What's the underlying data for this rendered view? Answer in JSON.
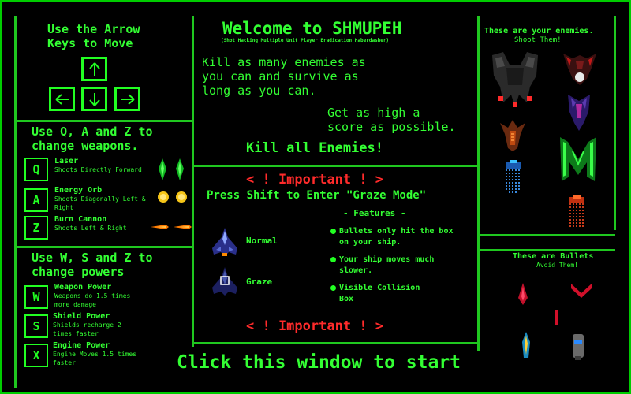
{
  "left_top": {
    "instructions": "Use the Arrow",
    "instructions2": "Keys to Move"
  },
  "weapons": {
    "header1": "Use Q, A and Z to",
    "header2": "change weapons.",
    "items": [
      {
        "key": "Q",
        "name": "Laser",
        "desc": "Shoots Directly Forward"
      },
      {
        "key": "A",
        "name": "Energy Orb",
        "desc": "Shoots Diagonally Left & Right"
      },
      {
        "key": "Z",
        "name": "Burn Cannon",
        "desc": "Shoots Left & Right"
      }
    ]
  },
  "powers": {
    "header1": "Use W, S and Z to",
    "header2": "change powers",
    "items": [
      {
        "key": "W",
        "name": "Weapon Power",
        "desc": "Weapons do 1.5 times more damage"
      },
      {
        "key": "S",
        "name": "Shield Power",
        "desc": "Shields recharge 2 times faster"
      },
      {
        "key": "X",
        "name": "Engine Power",
        "desc": "Engine Moves 1.5 times faster"
      }
    ]
  },
  "center": {
    "title": "Welcome to SHMUPEH",
    "subtitle": "(Shot Hacking Multiple Unit Player Eradication Haberdasher)",
    "line1": "Kill as many enemies as",
    "line2": "you can and survive as",
    "line3": "long as you can.",
    "line4": "Get as high a",
    "line5": "score as possible.",
    "kill": "Kill all Enemies!",
    "important": "< ! Important ! >",
    "shift": "Press Shift to Enter \"Graze Mode\"",
    "features_title": "- Features -",
    "normal": "Normal",
    "graze": "Graze",
    "features": [
      "Bullets only hit the box on your ship.",
      "Your ship moves much slower.",
      "Visible Collision Box"
    ],
    "important2": "< ! Important ! >",
    "start": "Click this window to start"
  },
  "right": {
    "enemies_title": "These are your enemies.",
    "enemies_sub": "Shoot Them!",
    "bullets_title": "These are Bullets",
    "bullets_sub": "Avoid Them!"
  },
  "colors": {
    "green": "#22ff22",
    "red": "#ff2b2b",
    "frame": "#1fc71f"
  }
}
